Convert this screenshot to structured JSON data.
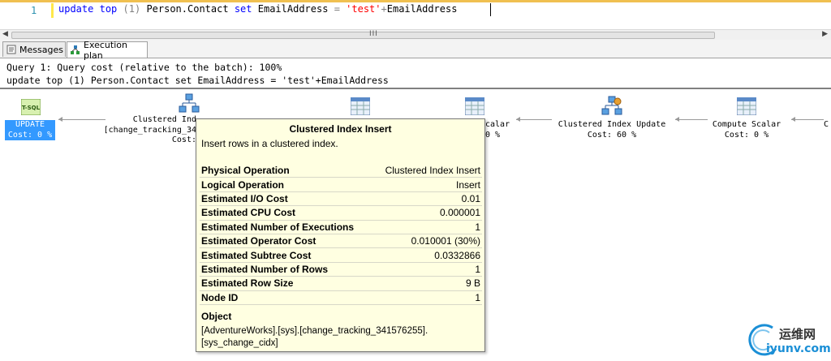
{
  "editor": {
    "line_number": "1",
    "sql_kw1": "update",
    "sql_kw2": "top",
    "sql_paren": "(1)",
    "sql_obj": "Person.Contact",
    "sql_kw3": "set",
    "sql_col": "EmailAddress",
    "sql_eq": "=",
    "sql_str": "'test'",
    "sql_plus": "+",
    "sql_col2": "EmailAddress"
  },
  "scrollbar": {
    "left_arrow": "◀",
    "right_arrow": "▶",
    "grip": "III"
  },
  "tabs": [
    {
      "label": "Messages"
    },
    {
      "label": "Execution plan"
    }
  ],
  "query": {
    "line1": "Query 1: Query cost (relative to the batch): 100%",
    "line2": "update top (1) Person.Contact set EmailAddress = 'test'+EmailAddress"
  },
  "plan": {
    "update": {
      "icon_text": "T-SQL",
      "name": "UPDATE",
      "cost": "Cost: 0 %"
    },
    "ci_insert": {
      "line1": "Clustered Ind",
      "line2": "[change_tracking_34",
      "cost": "Cost:"
    },
    "scalar_partial": {
      "line1": "calar",
      "cost": "0 %"
    },
    "ci_update": {
      "name": "Clustered Index Update",
      "cost": "Cost: 60 %"
    },
    "compute_scalar": {
      "name": "Compute Scalar",
      "cost": "Cost: 0 %"
    },
    "edge": {
      "name": "C"
    }
  },
  "tooltip": {
    "title": "Clustered Index Insert",
    "desc": "Insert rows in a clustered index.",
    "props": [
      {
        "k": "Physical Operation",
        "v": "Clustered Index Insert"
      },
      {
        "k": "Logical Operation",
        "v": "Insert"
      },
      {
        "k": "Estimated I/O Cost",
        "v": "0.01"
      },
      {
        "k": "Estimated CPU Cost",
        "v": "0.000001"
      },
      {
        "k": "Estimated Number of Executions",
        "v": "1"
      },
      {
        "k": "Estimated Operator Cost",
        "v": "0.010001 (30%)"
      },
      {
        "k": "Estimated Subtree Cost",
        "v": "0.0332866"
      },
      {
        "k": "Estimated Number of Rows",
        "v": "1"
      },
      {
        "k": "Estimated Row Size",
        "v": "9 B"
      },
      {
        "k": "Node ID",
        "v": "1"
      }
    ],
    "object_label": "Object",
    "object_line1": "[AdventureWorks].[sys].[change_tracking_341576255].",
    "object_line2": "[sys_change_cidx]"
  },
  "watermark": {
    "cn": "运维网",
    "en": "iyunv.com"
  },
  "colors": {
    "keyword": "#0000ff",
    "string": "#ff0000",
    "selected": "#3399ff",
    "tooltip_bg": "#ffffe1"
  }
}
